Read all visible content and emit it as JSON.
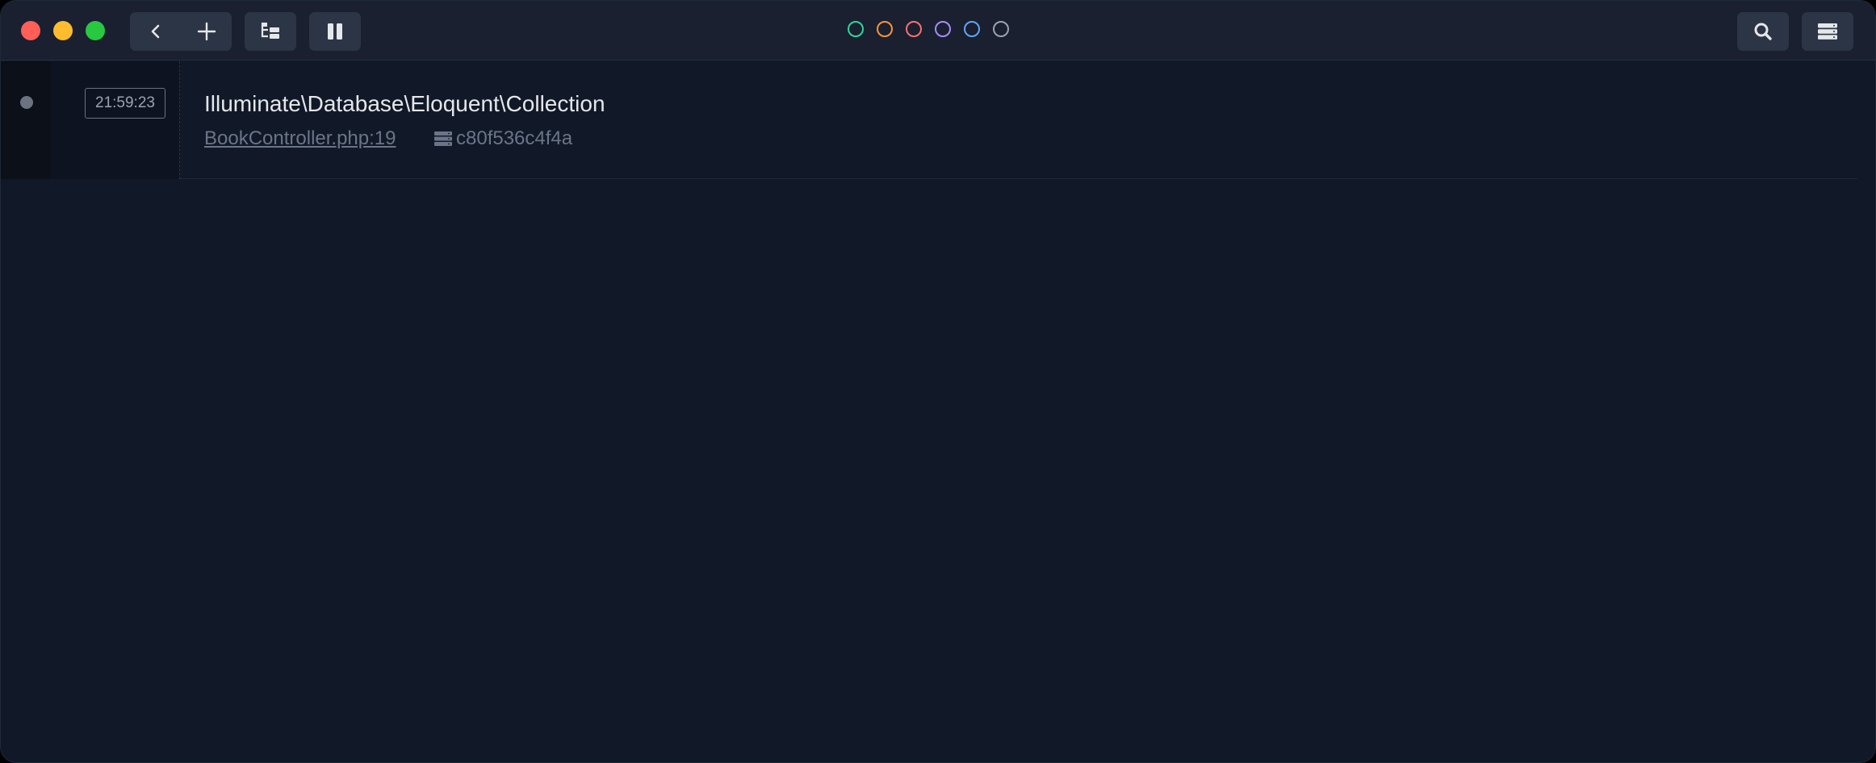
{
  "toolbar": {
    "back_icon": "chevron-left-icon",
    "add_icon": "plus-icon",
    "tree_icon": "tree-structure-icon",
    "pause_icon": "pause-icon",
    "search_icon": "search-icon",
    "menu_icon": "server-stack-icon"
  },
  "color_filters": [
    {
      "name": "green",
      "color": "#34d399"
    },
    {
      "name": "orange",
      "color": "#fb923c"
    },
    {
      "name": "red",
      "color": "#f87171"
    },
    {
      "name": "purple",
      "color": "#a78bfa"
    },
    {
      "name": "blue",
      "color": "#60a5fa"
    },
    {
      "name": "gray",
      "color": "#9ca3af"
    }
  ],
  "entries": [
    {
      "time": "21:59:23",
      "title": "Illuminate\\Database\\Eloquent\\Collection",
      "source": "BookController.php:19",
      "hash": "c80f536c4f4a",
      "hash_icon": "server-icon"
    }
  ]
}
